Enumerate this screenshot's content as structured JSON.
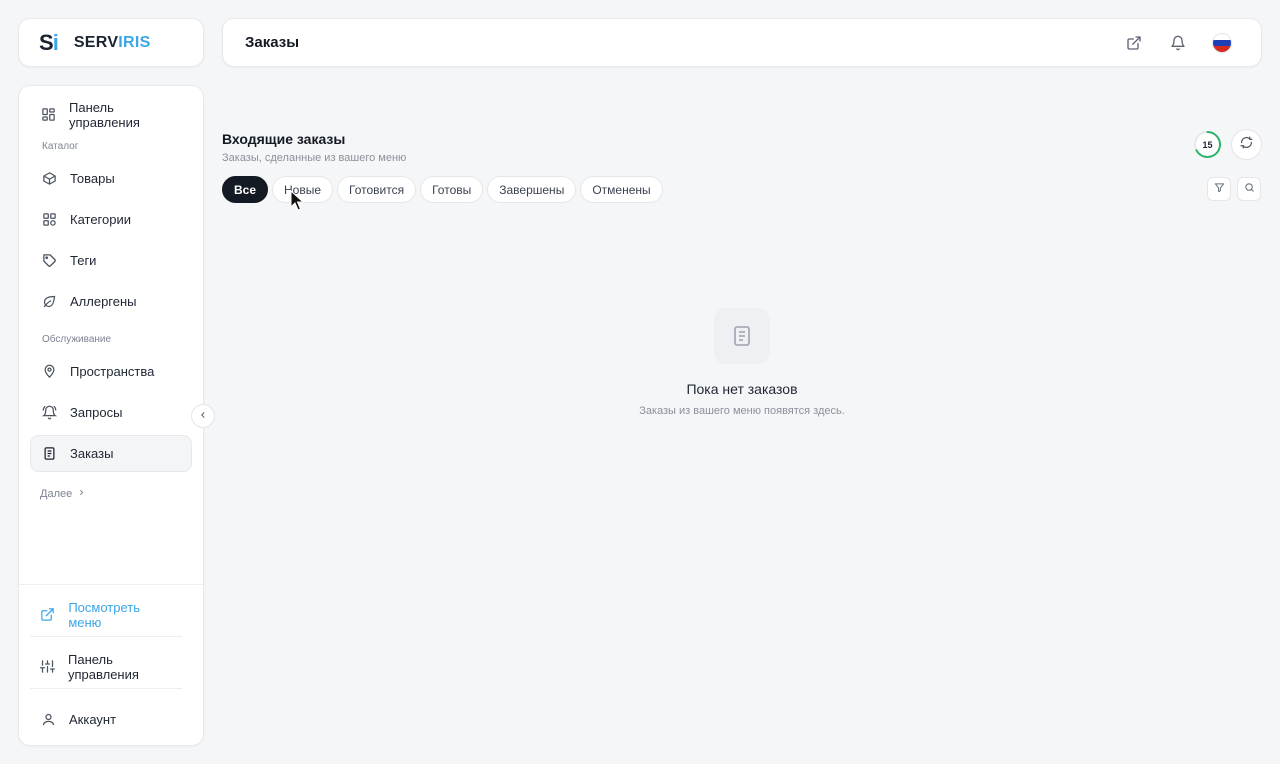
{
  "brand": {
    "mark_s": "S",
    "mark_i": "i",
    "name_part1": "SERV",
    "name_part2": "IRIS",
    "accent_color": "#3ba6e6"
  },
  "header": {
    "title": "Заказы",
    "icons": [
      "external-link-icon",
      "bell-icon",
      "russia-flag-icon"
    ]
  },
  "sidebar": {
    "top_item": {
      "label": "Панель управления",
      "icon": "dashboard-icon"
    },
    "catalog_label": "Каталог",
    "catalog_items": [
      {
        "label": "Товары",
        "icon": "box-icon"
      },
      {
        "label": "Категории",
        "icon": "grid-icon"
      },
      {
        "label": "Теги",
        "icon": "tag-icon"
      },
      {
        "label": "Аллергены",
        "icon": "leaf-icon"
      }
    ],
    "service_label": "Обслуживание",
    "service_items": [
      {
        "label": "Пространства",
        "icon": "location-pin-icon"
      },
      {
        "label": "Запросы",
        "icon": "bell-icon"
      },
      {
        "label": "Заказы",
        "icon": "receipt-icon",
        "active": true
      }
    ],
    "more_label": "Далее",
    "bottom_items": [
      {
        "label": "Посмотреть меню",
        "icon": "external-link-icon"
      },
      {
        "label": "Панель управления",
        "icon": "sliders-icon"
      },
      {
        "label": "Аккаунт",
        "icon": "user-icon"
      }
    ]
  },
  "main": {
    "title": "Входящие заказы",
    "subtitle": "Заказы, сделанные из вашего меню",
    "timer_value": "15",
    "tabs": [
      {
        "label": "Все",
        "active": true
      },
      {
        "label": "Новые"
      },
      {
        "label": "Готовится"
      },
      {
        "label": "Готовы"
      },
      {
        "label": "Завершены"
      },
      {
        "label": "Отменены"
      }
    ],
    "empty_title": "Пока нет заказов",
    "empty_text": "Заказы из вашего меню появятся здесь."
  }
}
